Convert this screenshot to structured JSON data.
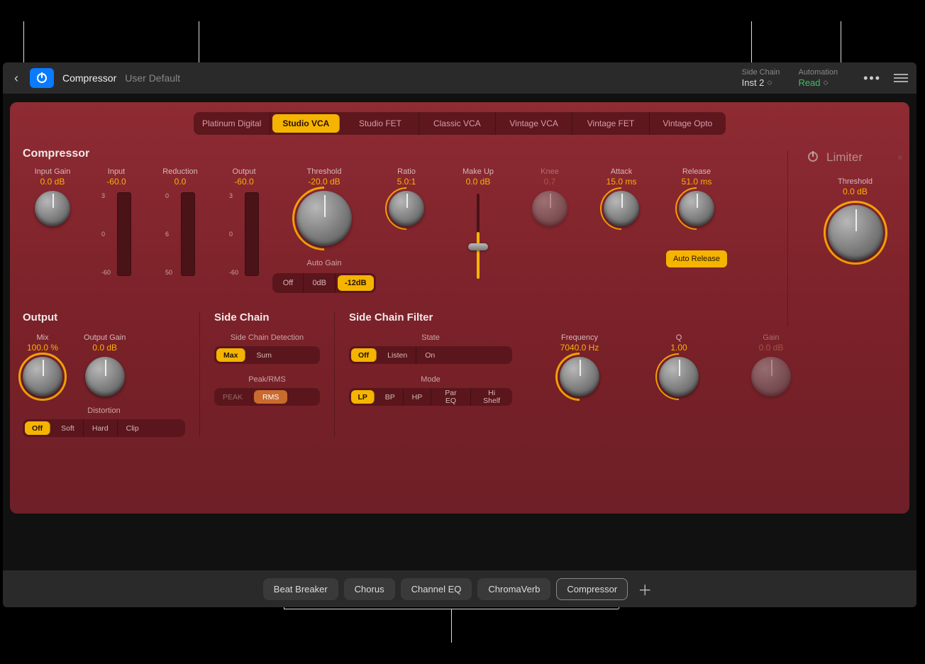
{
  "header": {
    "plugin_name": "Compressor",
    "preset": "User Default",
    "sidechain_label": "Side Chain",
    "sidechain_value": "Inst 2",
    "automation_label": "Automation",
    "automation_value": "Read"
  },
  "tabs": [
    "Platinum Digital",
    "Studio VCA",
    "Studio FET",
    "Classic VCA",
    "Vintage VCA",
    "Vintage FET",
    "Vintage Opto"
  ],
  "tab_active": "Studio VCA",
  "compressor_title": "Compressor",
  "params": {
    "input_gain": {
      "label": "Input Gain",
      "value": "0.0 dB"
    },
    "input_meter": {
      "label": "Input",
      "value": "-60.0",
      "ticks": [
        "3",
        "0",
        "-60"
      ]
    },
    "reduction_meter": {
      "label": "Reduction",
      "value": "0.0",
      "ticks": [
        "0",
        "6",
        "50"
      ]
    },
    "output_meter": {
      "label": "Output",
      "value": "-60.0",
      "ticks": [
        "3",
        "0",
        "-60"
      ]
    },
    "threshold": {
      "label": "Threshold",
      "value": "-20.0 dB"
    },
    "ratio": {
      "label": "Ratio",
      "value": "5.0:1"
    },
    "makeup": {
      "label": "Make Up",
      "value": "0.0 dB"
    },
    "knee": {
      "label": "Knee",
      "value": "0.7"
    },
    "attack": {
      "label": "Attack",
      "value": "15.0 ms"
    },
    "release": {
      "label": "Release",
      "value": "51.0 ms"
    },
    "auto_release": "Auto Release",
    "auto_gain_label": "Auto Gain",
    "auto_gain_opts": [
      "Off",
      "0dB",
      "-12dB"
    ],
    "auto_gain_sel": "-12dB"
  },
  "limiter": {
    "title": "Limiter",
    "threshold_label": "Threshold",
    "threshold_value": "0.0 dB"
  },
  "output_panel": {
    "title": "Output",
    "mix": {
      "label": "Mix",
      "value": "100.0 %"
    },
    "output_gain": {
      "label": "Output Gain",
      "value": "0.0 dB"
    },
    "distortion_label": "Distortion",
    "distortion_opts": [
      "Off",
      "Soft",
      "Hard",
      "Clip"
    ],
    "distortion_sel": "Off"
  },
  "sidechain_panel": {
    "title": "Side Chain",
    "detection_label": "Side Chain Detection",
    "detection_opts": [
      "Max",
      "Sum"
    ],
    "detection_sel": "Max",
    "peakrms_label": "Peak/RMS",
    "peakrms_opts": [
      "PEAK",
      "RMS"
    ],
    "peakrms_sel": "RMS"
  },
  "scfilter_panel": {
    "title": "Side Chain Filter",
    "state_label": "State",
    "state_opts": [
      "Off",
      "Listen",
      "On"
    ],
    "state_sel": "Off",
    "mode_label": "Mode",
    "mode_opts": [
      "LP",
      "BP",
      "HP",
      "Par EQ",
      "Hi Shelf"
    ],
    "mode_sel": "LP",
    "frequency": {
      "label": "Frequency",
      "value": "7040.0 Hz"
    },
    "q": {
      "label": "Q",
      "value": "1.00"
    },
    "gain": {
      "label": "Gain",
      "value": "0.0 dB"
    }
  },
  "chain": {
    "items": [
      "Beat Breaker",
      "Chorus",
      "Channel EQ",
      "ChromaVerb",
      "Compressor"
    ],
    "active": "Compressor"
  }
}
